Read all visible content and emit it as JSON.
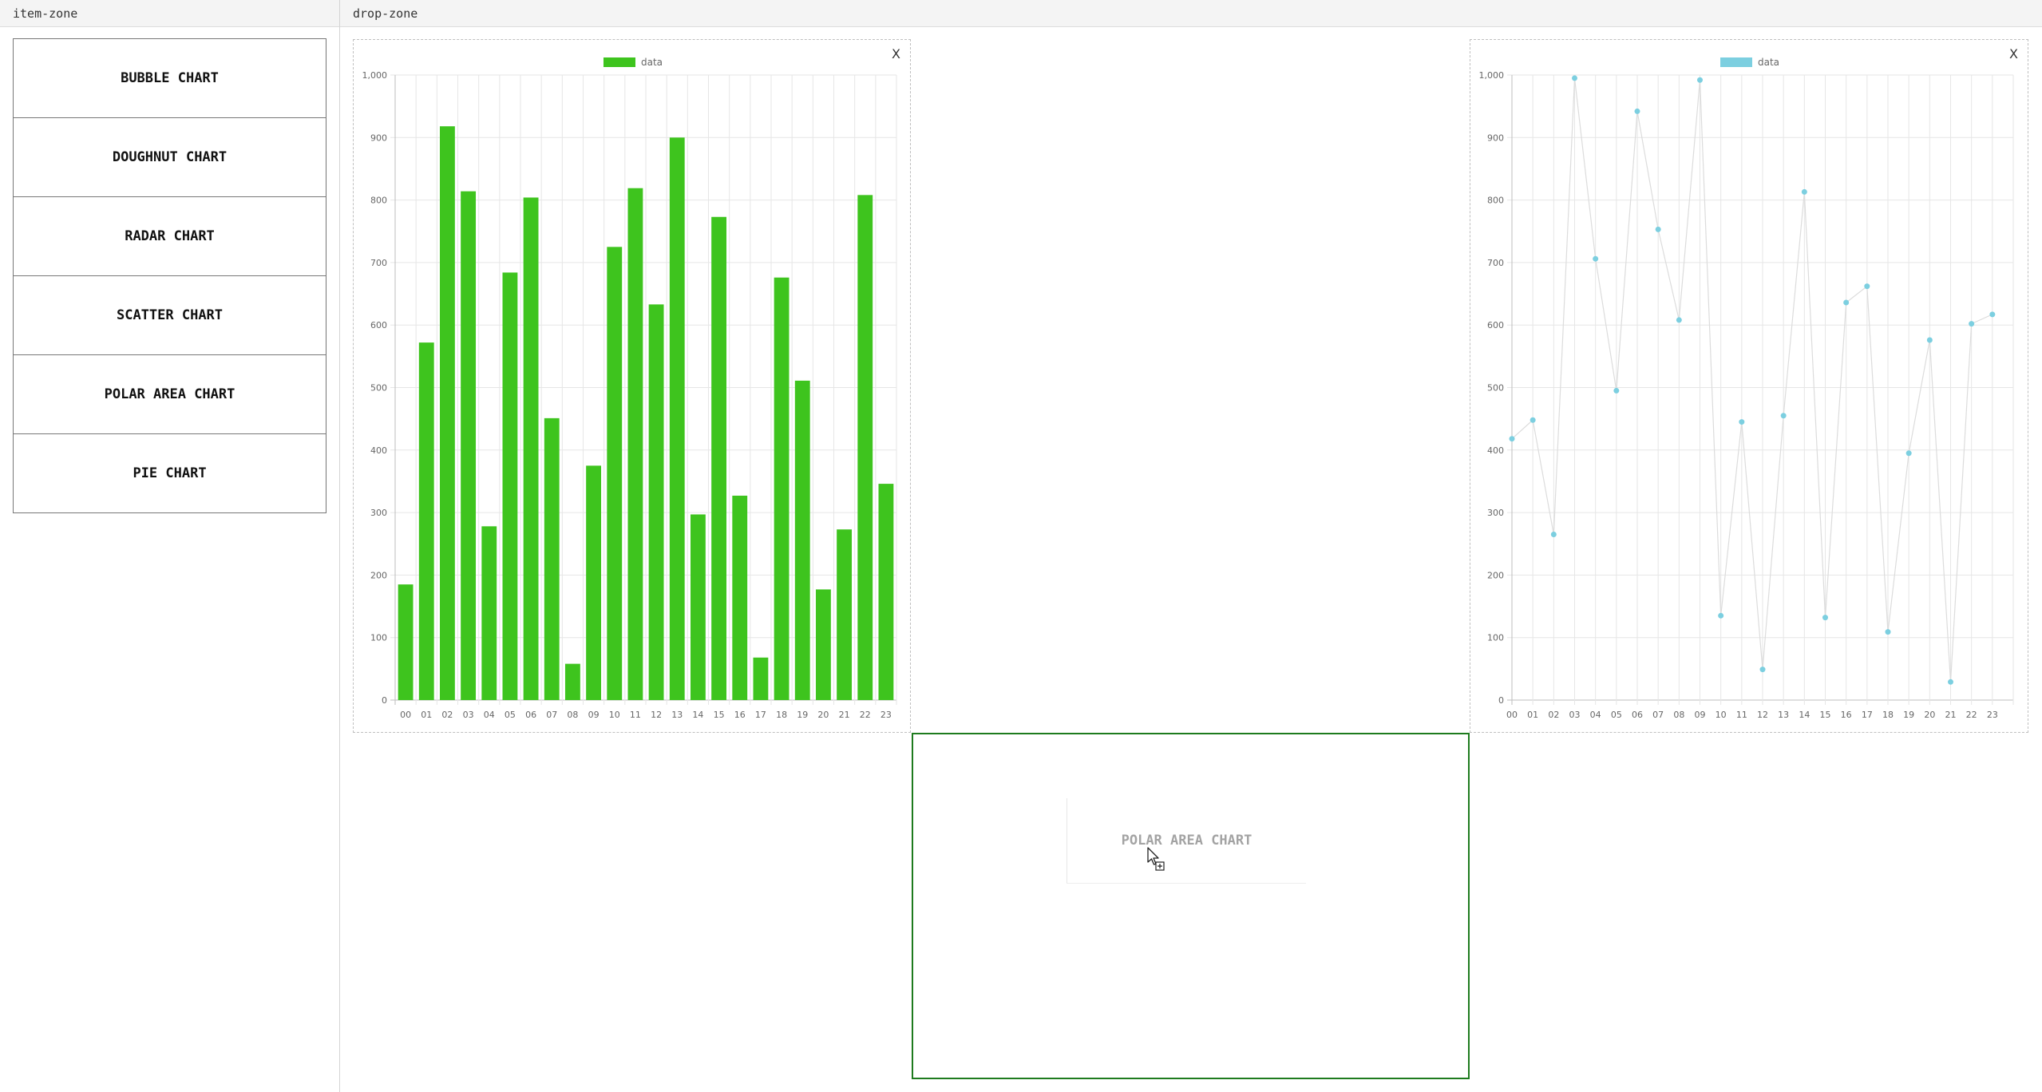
{
  "item_zone": {
    "title": "item-zone",
    "items": [
      {
        "label": "BUBBLE CHART"
      },
      {
        "label": "DOUGHNUT CHART"
      },
      {
        "label": "RADAR CHART"
      },
      {
        "label": "SCATTER CHART"
      },
      {
        "label": "POLAR AREA CHART"
      },
      {
        "label": "PIE CHART"
      }
    ]
  },
  "drop_zone": {
    "title": "drop-zone",
    "close_label": "X",
    "drag_ghost_label": "POLAR AREA CHART"
  },
  "chart_data": [
    {
      "type": "bar",
      "legend": "data",
      "legend_position": "top",
      "color": "#3ec41e",
      "categories": [
        "00",
        "01",
        "02",
        "03",
        "04",
        "05",
        "06",
        "07",
        "08",
        "09",
        "10",
        "11",
        "12",
        "13",
        "14",
        "15",
        "16",
        "17",
        "18",
        "19",
        "20",
        "21",
        "22",
        "23"
      ],
      "values": [
        185,
        572,
        918,
        814,
        278,
        684,
        804,
        451,
        58,
        375,
        725,
        819,
        633,
        900,
        297,
        773,
        327,
        68,
        676,
        511,
        177,
        273,
        808,
        346
      ],
      "ylim": [
        0,
        1000
      ],
      "yticks": [
        "0",
        "100",
        "200",
        "300",
        "400",
        "500",
        "600",
        "700",
        "800",
        "900",
        "1,000"
      ],
      "grid": true
    },
    {
      "type": "line",
      "legend": "data",
      "legend_position": "top",
      "color": "#7ccfe0",
      "categories": [
        "00",
        "01",
        "02",
        "03",
        "04",
        "05",
        "06",
        "07",
        "08",
        "09",
        "10",
        "11",
        "12",
        "13",
        "14",
        "15",
        "16",
        "17",
        "18",
        "19",
        "20",
        "21",
        "22",
        "23"
      ],
      "values": [
        418,
        448,
        265,
        995,
        706,
        495,
        942,
        753,
        608,
        992,
        135,
        445,
        49,
        455,
        813,
        132,
        636,
        662,
        109,
        395,
        576,
        29,
        602,
        617
      ],
      "ylim": [
        0,
        1000
      ],
      "yticks": [
        "0",
        "100",
        "200",
        "300",
        "400",
        "500",
        "600",
        "700",
        "800",
        "900",
        "1,000"
      ],
      "grid": true
    }
  ]
}
